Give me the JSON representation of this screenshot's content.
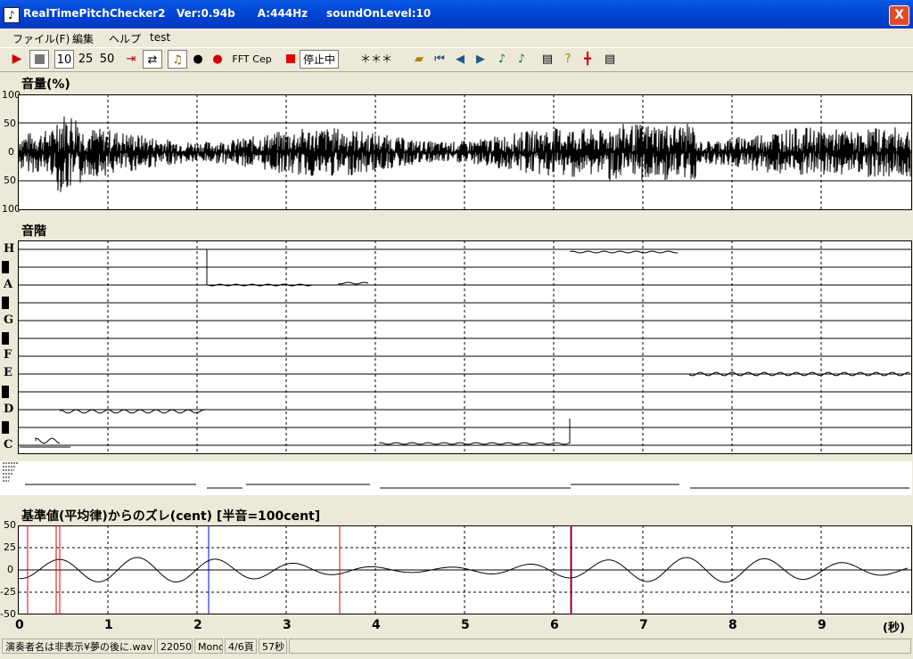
{
  "window": {
    "title": "RealTimePitchChecker2   Ver:0.94b      A:444Hz     soundOnLevel:10",
    "icon": "music-note-icon",
    "close_label": "X"
  },
  "menu": {
    "items": [
      "ファイル(F)",
      "編集",
      "ヘルプ",
      "test"
    ]
  },
  "toolbar": {
    "play_icon": "play-icon",
    "stop_icon": "stop-icon",
    "speed_buttons": [
      "10",
      "25",
      "50"
    ],
    "fft_label": "FFT",
    "cep_label": "Cep",
    "status_label": "停止中",
    "note_display": "＊＊＊"
  },
  "volume_panel": {
    "title": "音量(%)",
    "y_ticks": [
      "100",
      "50",
      "0",
      "50",
      "100"
    ]
  },
  "scale_panel": {
    "title": "音階",
    "notes": [
      "H",
      "A",
      "G",
      "F",
      "E",
      "D",
      "C"
    ]
  },
  "cent_panel": {
    "title": "基準値(平均律)からのズレ(cent) [半音=100cent]",
    "y_ticks": [
      "50",
      "25",
      "0",
      "-25",
      "-50"
    ]
  },
  "time_axis": {
    "ticks": [
      "0",
      "1",
      "2",
      "3",
      "4",
      "5",
      "6",
      "7",
      "8",
      "9"
    ],
    "unit": "(秒)"
  },
  "statusbar": {
    "file": "演奏者名は非表示¥夢の後に.wav",
    "rate": "22050",
    "channels": "Mono",
    "page": "4/6頁",
    "duration": "57秒"
  },
  "colors": {
    "titlebar": "#0046d5",
    "marker_red": "#e00000",
    "marker_blue": "#0000d0"
  }
}
